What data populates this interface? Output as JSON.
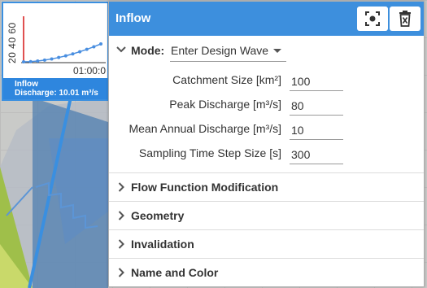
{
  "thumbnail": {
    "y_ticks": "20 40 60",
    "x_tick": "01:00:0",
    "caption_title": "Inflow",
    "caption_value": "Discharge: 10.01 m³/s"
  },
  "panel": {
    "title": "Inflow",
    "focus_icon": "focus-icon",
    "delete_icon": "trash-icon"
  },
  "mode": {
    "label": "Mode:",
    "selected": "Enter Design Wave"
  },
  "fields": [
    {
      "label": "Catchment Size [km²]",
      "value": "100"
    },
    {
      "label": "Peak Discharge [m³/s]",
      "value": "80"
    },
    {
      "label": "Mean Annual Discharge [m³/s]",
      "value": "10"
    },
    {
      "label": "Sampling Time Step Size [s]",
      "value": "300"
    }
  ],
  "sections": [
    {
      "label": "Flow Function Modification"
    },
    {
      "label": "Geometry"
    },
    {
      "label": "Invalidation"
    },
    {
      "label": "Name and Color"
    }
  ],
  "colors": {
    "header": "#3d8fdd",
    "accent": "#2e86de",
    "series": "#4a8fe0",
    "marker": "#e05050"
  }
}
